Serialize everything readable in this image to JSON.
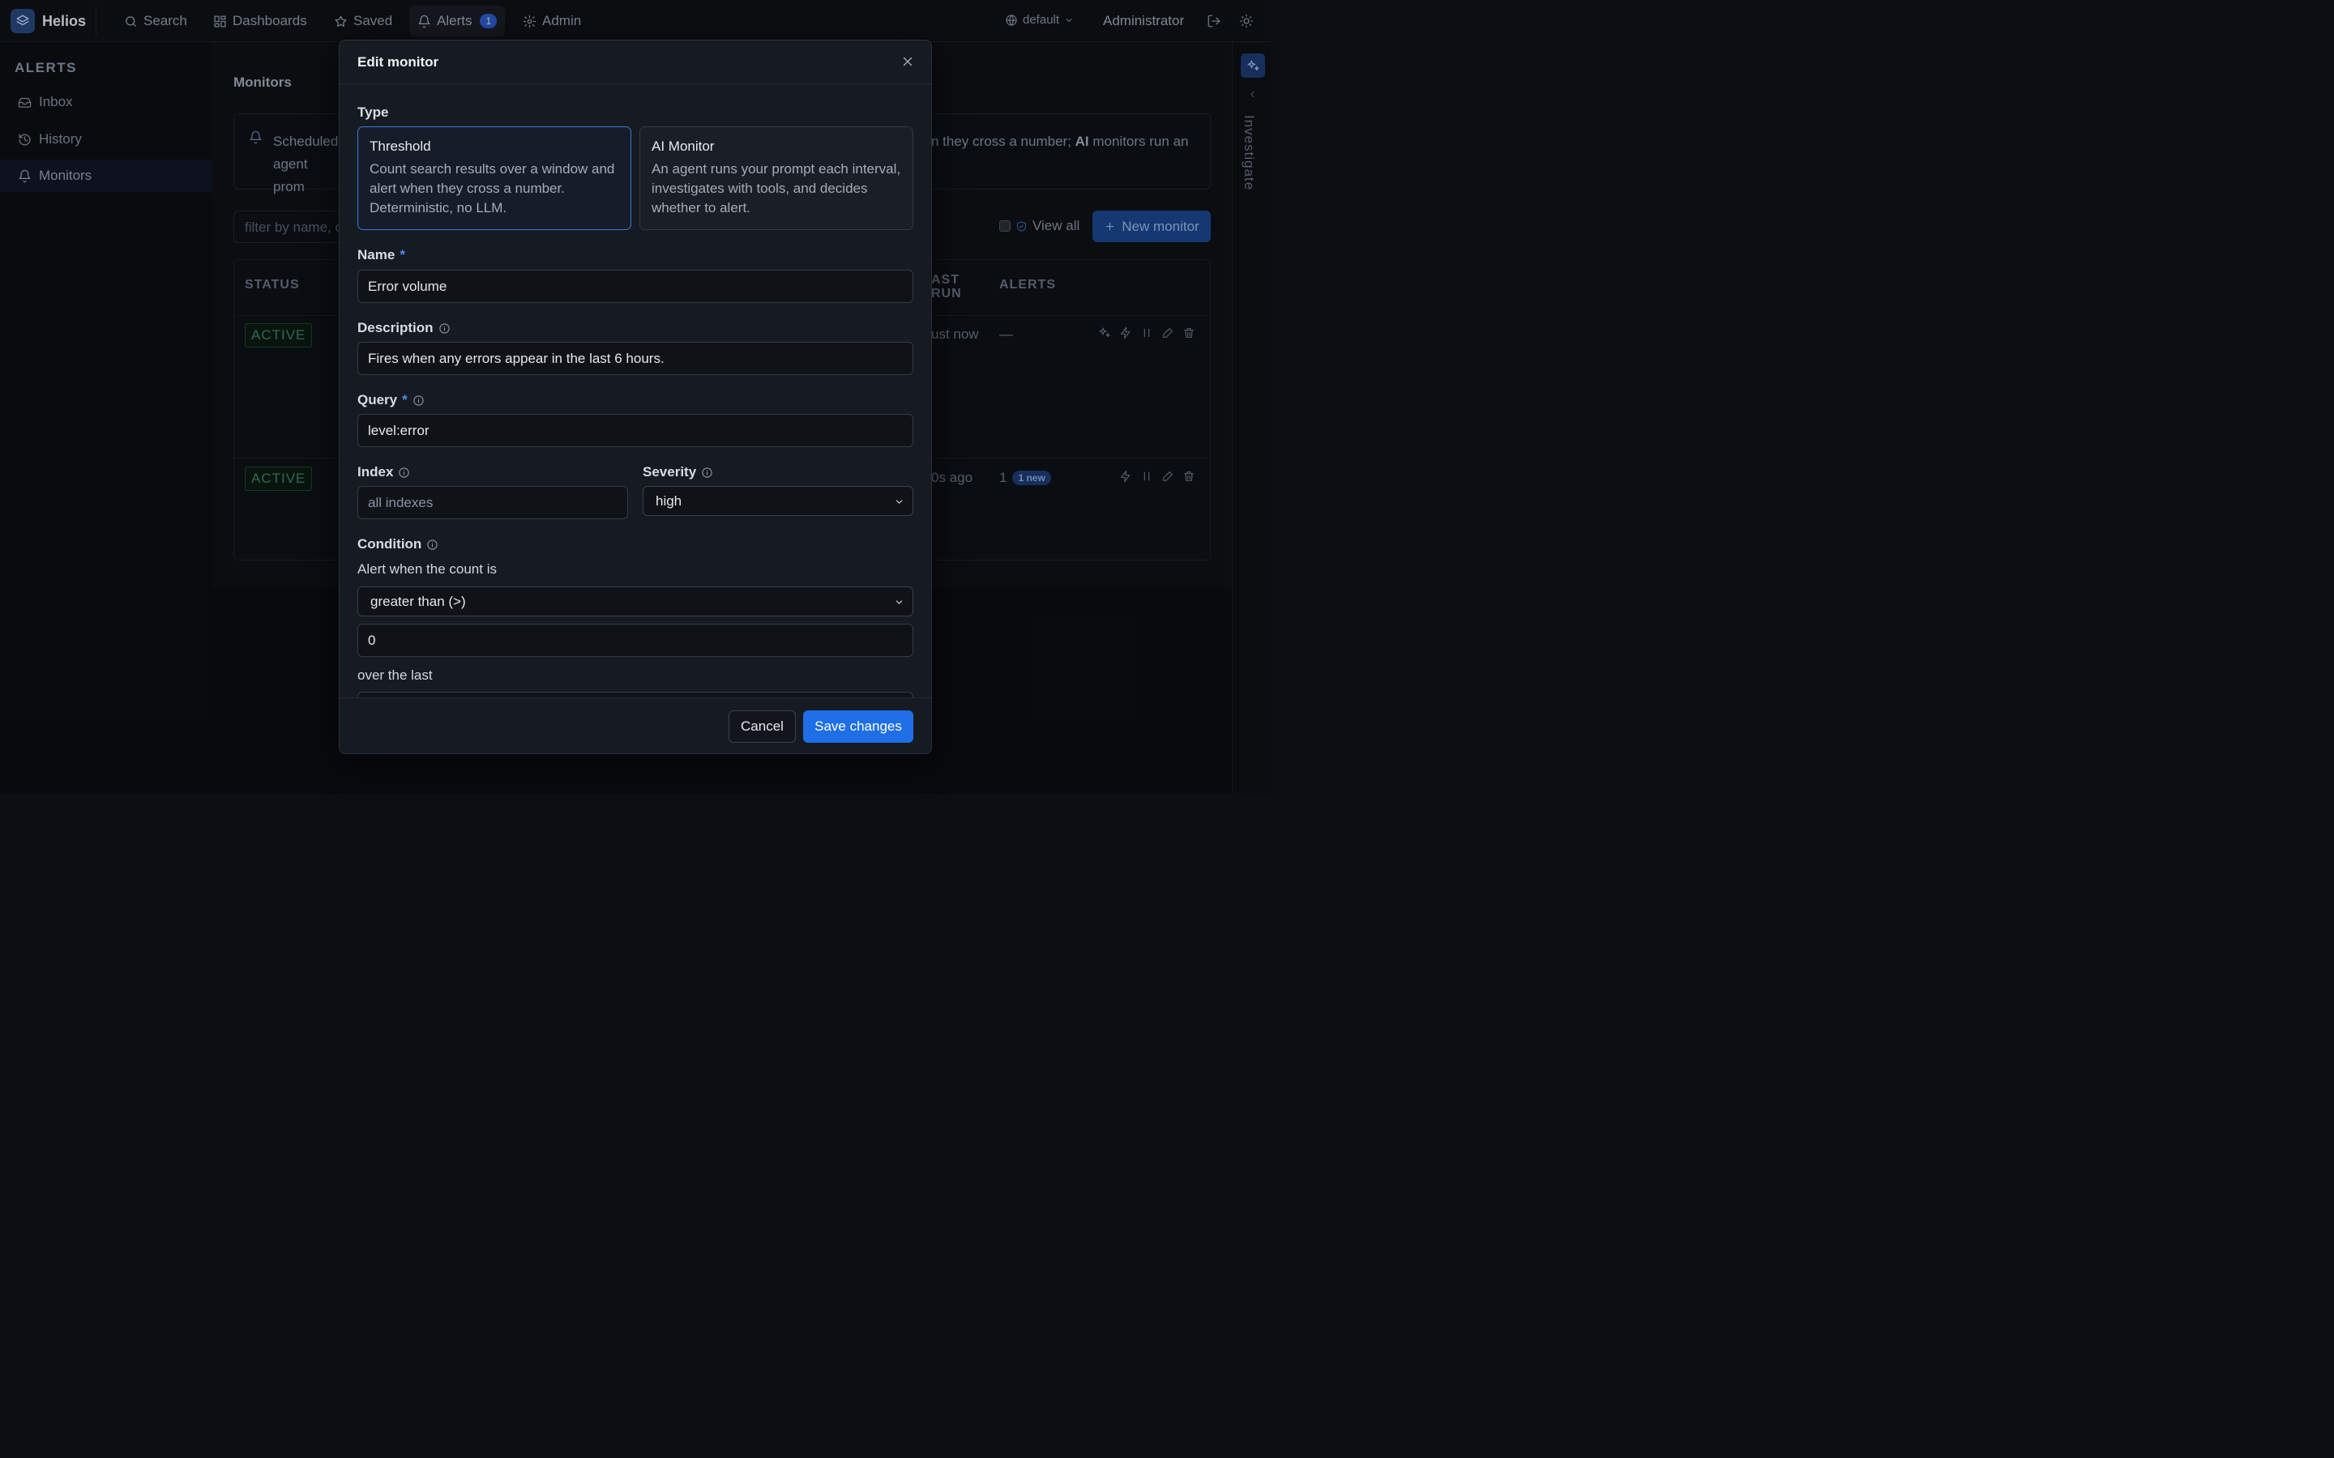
{
  "app": {
    "name": "Helios"
  },
  "nav": {
    "items": [
      {
        "label": "Search",
        "icon": "search-icon"
      },
      {
        "label": "Dashboards",
        "icon": "dashboards-icon"
      },
      {
        "label": "Saved",
        "icon": "star-icon"
      },
      {
        "label": "Alerts",
        "icon": "bell-icon",
        "badge": "1",
        "active": true
      },
      {
        "label": "Admin",
        "icon": "gear-icon"
      }
    ],
    "namespace": "default",
    "user": "Administrator"
  },
  "sidebar": {
    "title": "ALERTS",
    "items": [
      {
        "label": "Inbox",
        "icon": "inbox-icon"
      },
      {
        "label": "History",
        "icon": "history-icon"
      },
      {
        "label": "Monitors",
        "icon": "bell-icon",
        "active": true
      }
    ]
  },
  "main": {
    "title": "Monitors",
    "info_left": "Scheduled agent prom",
    "info_right_a": "n they cross a number; ",
    "info_right_b": "AI",
    "info_right_c": " monitors run an",
    "filter_placeholder": "filter by name, c",
    "view_all_label": "View all",
    "new_monitor_label": "New monitor",
    "table": {
      "col_status": "STATUS",
      "col_last_run_1": "AST",
      "col_last_run_2": "RUN",
      "col_alerts": "ALERTS",
      "rows": [
        {
          "status": "ACTIVE",
          "last_run": "ust now",
          "alerts": "—",
          "new": ""
        },
        {
          "status": "ACTIVE",
          "last_run": "0s ago",
          "alerts": "1",
          "new": "1 new"
        }
      ]
    }
  },
  "rail": {
    "label": "Investigate"
  },
  "modal": {
    "title": "Edit monitor",
    "type_label": "Type",
    "types": [
      {
        "title": "Threshold",
        "desc": "Count search results over a window and alert when they cross a number. Deterministic, no LLM.",
        "selected": true
      },
      {
        "title": "AI Monitor",
        "desc": "An agent runs your prompt each interval, investigates with tools, and decides whether to alert.",
        "selected": false
      }
    ],
    "name_label": "Name",
    "name_value": "Error volume",
    "description_label": "Description",
    "description_value": "Fires when any errors appear in the last 6 hours.",
    "query_label": "Query",
    "query_value": "level:error",
    "index_label": "Index",
    "index_placeholder": "all indexes",
    "severity_label": "Severity",
    "severity_value": "high",
    "condition_label": "Condition",
    "condition_text": "Alert when the count is",
    "operator_value": "greater than (>)",
    "threshold_value": "0",
    "window_text": "over the last",
    "required_mark": "*",
    "cancel_label": "Cancel",
    "save_label": "Save changes"
  },
  "colors": {
    "accent": "#1e6ee6",
    "active_status": "#3d8a60",
    "badge": "#2d5fd0"
  }
}
